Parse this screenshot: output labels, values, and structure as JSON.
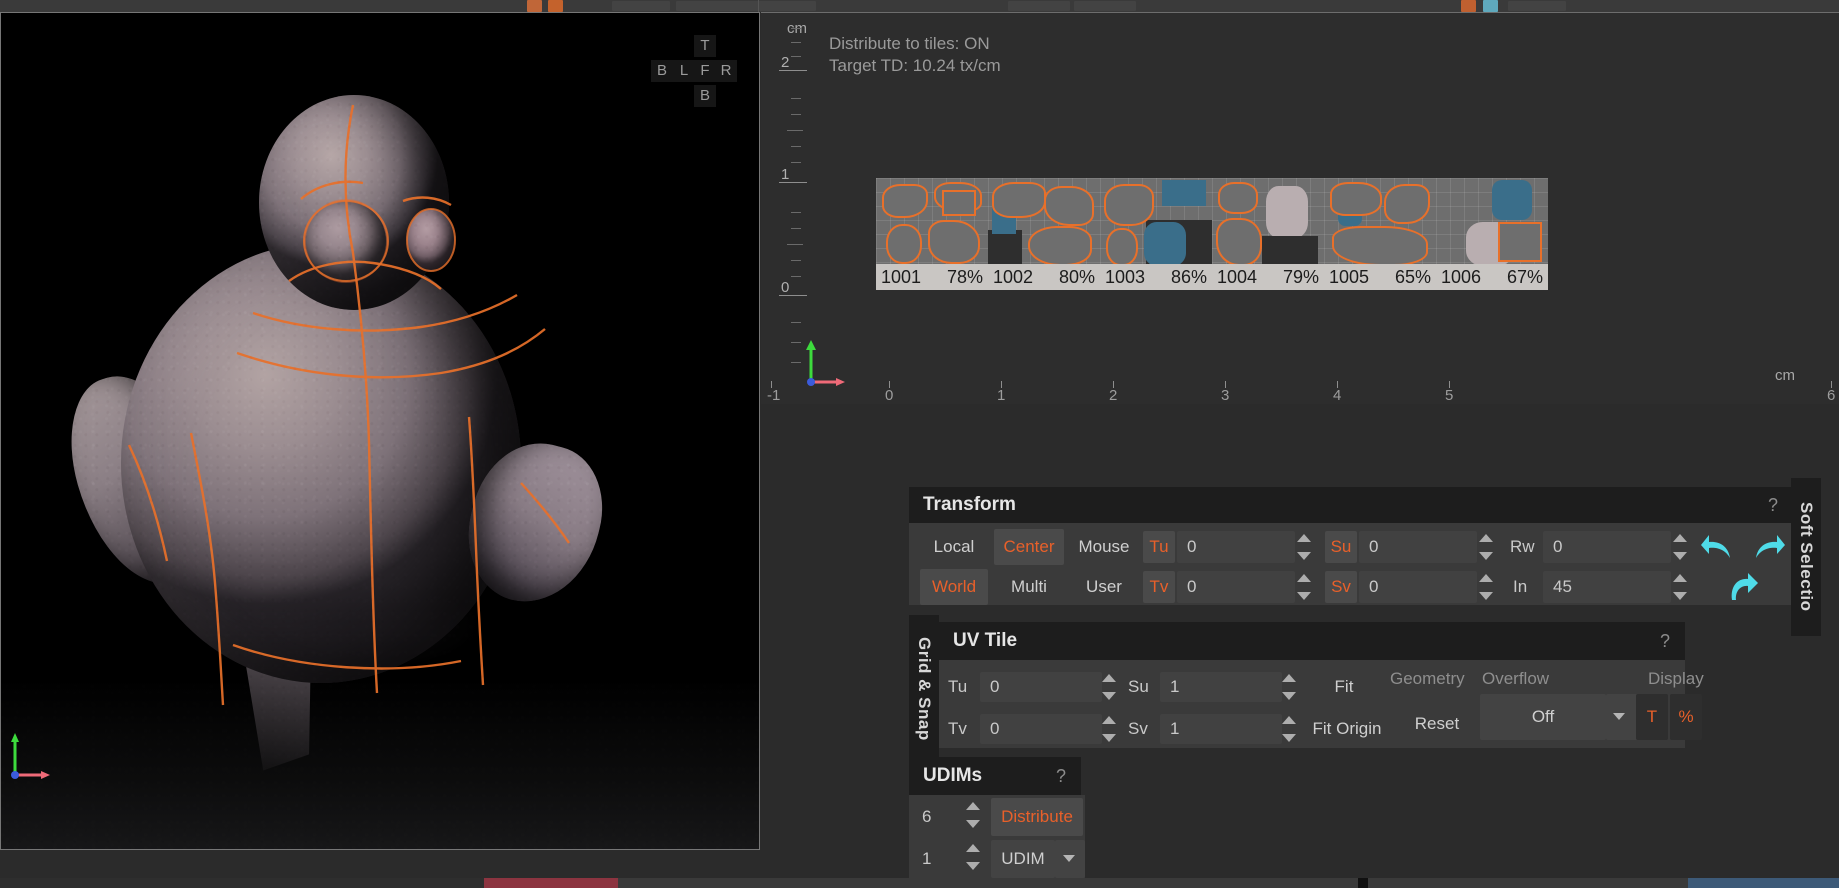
{
  "app": {
    "viewport": {
      "orientation_widget": {
        "top": "T",
        "bottom": "B",
        "row": [
          "B",
          "L",
          "F",
          "R"
        ]
      },
      "axis_gizmo_name": "axis-gizmo"
    },
    "uv_editor": {
      "unit_label_vertical": "cm",
      "unit_label_horizontal": "cm",
      "info_line_1": "Distribute to tiles: ON",
      "info_line_2": "Target TD: 10.24 tx/cm",
      "vertical_ticks": [
        "2",
        "1",
        "0"
      ],
      "horizontal_ticks": [
        "-1",
        "0",
        "1",
        "2",
        "3",
        "4",
        "5",
        "6"
      ],
      "tiles": [
        {
          "id": "1001",
          "coverage": "78%"
        },
        {
          "id": "1002",
          "coverage": "80%"
        },
        {
          "id": "1003",
          "coverage": "86%"
        },
        {
          "id": "1004",
          "coverage": "79%"
        },
        {
          "id": "1005",
          "coverage": "65%"
        },
        {
          "id": "1006",
          "coverage": "67%"
        }
      ]
    },
    "transform_panel": {
      "title": "Transform",
      "help": "?",
      "space_buttons": [
        {
          "label": "Local",
          "active": false
        },
        {
          "label": "Center",
          "active": true
        },
        {
          "label": "Mouse",
          "active": false
        },
        {
          "label": "World",
          "active": true
        },
        {
          "label": "Multi",
          "active": false
        },
        {
          "label": "User",
          "active": false
        }
      ],
      "fields": [
        {
          "tag": "Tu",
          "value": "0"
        },
        {
          "tag": "Tv",
          "value": "0"
        },
        {
          "tag": "Su",
          "value": "0"
        },
        {
          "tag": "Sv",
          "value": "0"
        },
        {
          "tag": "Rw",
          "value": "0"
        },
        {
          "tag": "In",
          "value": "45"
        }
      ],
      "undo_icon": "undo-arrow-icon",
      "redo_icon": "redo-arrow-icon",
      "reapply_icon": "reapply-arrow-icon",
      "accent_color": "#e8602a",
      "arrow_color": "#4fdbe8"
    },
    "uv_tile_panel": {
      "title": "UV Tile",
      "help": "?",
      "tu_label": "Tu",
      "tu_value": "0",
      "tv_label": "Tv",
      "tv_value": "0",
      "su_label": "Su",
      "su_value": "1",
      "sv_label": "Sv",
      "sv_value": "1",
      "fit_label": "Fit",
      "fit_origin_label": "Fit Origin",
      "geometry_label": "Geometry",
      "reset_label": "Reset",
      "overflow_label": "Overflow",
      "overflow_value": "Off",
      "display_label": "Display",
      "display_t": "T",
      "display_percent": "%"
    },
    "udims_panel": {
      "title": "UDIMs",
      "help": "?",
      "count_value": "6",
      "distribute_label": "Distribute",
      "index_value": "1",
      "mode_value": "UDIM"
    },
    "side_tabs": {
      "grid_snap": "Grid & Snap",
      "soft_selection": "Soft Selectio"
    }
  }
}
